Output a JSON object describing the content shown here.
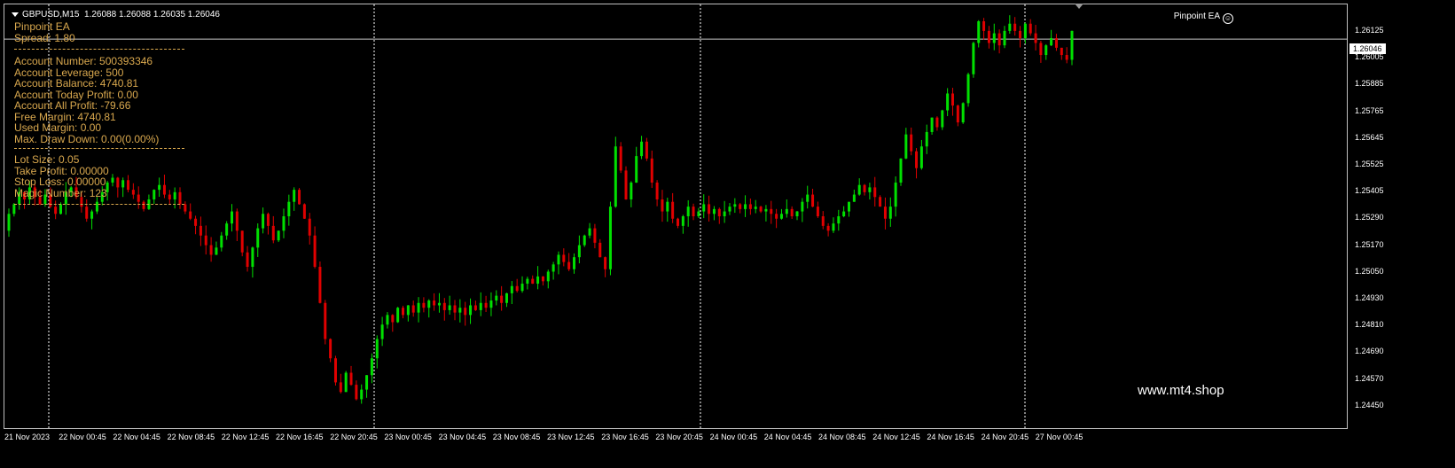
{
  "header": {
    "symbol": "GBPUSD,M15",
    "ohlc": "1.26088 1.26088 1.26035 1.26046",
    "ea_name": "Pinpoint EA",
    "ea_icon": "smiley-icon"
  },
  "info_panel": {
    "block1": [
      "Pinpoint EA",
      "Spread: 1.80"
    ],
    "block2": [
      "Account Number: 500393346",
      "Account Leverage: 500",
      "Account Balance: 4740.81",
      "Account Today Profit: 0.00",
      "Account All Profit: -79.66",
      "Free Margin: 4740.81",
      "Used Margin: 0.00",
      "Max. Draw Down: 0.00(0.00%)"
    ],
    "block3": [
      "Lot Size: 0.05",
      "Take Profit: 0.00000",
      "Stop Loss: 0.00000",
      "Magic Number: 123"
    ],
    "text_color": "#d9a84e"
  },
  "price_axis": {
    "ticks": [
      "1.26125",
      "1.26005",
      "1.25885",
      "1.25765",
      "1.25645",
      "1.25525",
      "1.25405",
      "1.25290",
      "1.25170",
      "1.25050",
      "1.24930",
      "1.24810",
      "1.24690",
      "1.24570",
      "1.24450"
    ],
    "current_price": "1.26046"
  },
  "time_axis": {
    "ticks": [
      "21 Nov 2023",
      "22 Nov 00:45",
      "22 Nov 04:45",
      "22 Nov 08:45",
      "22 Nov 12:45",
      "22 Nov 16:45",
      "22 Nov 20:45",
      "23 Nov 00:45",
      "23 Nov 04:45",
      "23 Nov 08:45",
      "23 Nov 12:45",
      "23 Nov 16:45",
      "23 Nov 20:45",
      "24 Nov 00:45",
      "24 Nov 04:45",
      "24 Nov 08:45",
      "24 Nov 12:45",
      "24 Nov 16:45",
      "24 Nov 20:45",
      "27 Nov 00:45"
    ],
    "day_separators": [
      "22 Nov 00:45",
      "23 Nov 00:45",
      "24 Nov 00:45",
      "27 Nov 00:45"
    ]
  },
  "colors": {
    "bull": "#00e000",
    "bear": "#e00000",
    "background": "#000000",
    "foreground": "#ffffff"
  },
  "watermark": "www.mt4.shop",
  "chart_data": {
    "type": "candlestick",
    "ylim": [
      1.2443,
      1.2619
    ],
    "closes": [
      1.2532,
      1.2536,
      1.2541,
      1.2538,
      1.2543,
      1.2539,
      1.2536,
      1.254,
      1.2535,
      1.2532,
      1.2536,
      1.2541,
      1.2543,
      1.2539,
      1.2535,
      1.253,
      1.2533,
      1.2537,
      1.2541,
      1.2545,
      1.2547,
      1.2543,
      1.2546,
      1.2542,
      1.254,
      1.2537,
      1.2534,
      1.2538,
      1.2542,
      1.2544,
      1.254,
      1.2538,
      1.2541,
      1.2536,
      1.2533,
      1.253,
      1.2527,
      1.2523,
      1.2519,
      1.2515,
      1.2518,
      1.2523,
      1.2528,
      1.2533,
      1.2525,
      1.2516,
      1.251,
      1.2518,
      1.2526,
      1.2532,
      1.2527,
      1.2521,
      1.2525,
      1.2531,
      1.2537,
      1.2542,
      1.2536,
      1.253,
      1.2523,
      1.251,
      1.2495,
      1.248,
      1.2472,
      1.2462,
      1.2458,
      1.2466,
      1.2461,
      1.2455,
      1.2459,
      1.2465,
      1.2472,
      1.248,
      1.2486,
      1.249,
      1.2487,
      1.2493,
      1.249,
      1.2494,
      1.2491,
      1.2495,
      1.2493,
      1.2496,
      1.2494,
      1.2495,
      1.2492,
      1.2494,
      1.2491,
      1.2493,
      1.249,
      1.2494,
      1.2492,
      1.2495,
      1.2493,
      1.2496,
      1.2498,
      1.2495,
      1.2499,
      1.2502,
      1.25,
      1.2503,
      1.2505,
      1.2503,
      1.2506,
      1.2504,
      1.2508,
      1.2511,
      1.2515,
      1.2512,
      1.2509,
      1.2514,
      1.2519,
      1.2523,
      1.2526,
      1.252,
      1.2514,
      1.2509,
      1.2535,
      1.256,
      1.255,
      1.2538,
      1.2545,
      1.2556,
      1.2562,
      1.2555,
      1.2545,
      1.2538,
      1.2533,
      1.2537,
      1.253,
      1.2527,
      1.2531,
      1.2535,
      1.2531,
      1.2533,
      1.2536,
      1.2532,
      1.2534,
      1.2531,
      1.2533,
      1.2535,
      1.2536,
      1.2534,
      1.2536,
      1.2534,
      1.2535,
      1.2533,
      1.2534,
      1.2532,
      1.253,
      1.2532,
      1.2534,
      1.2531,
      1.2533,
      1.2537,
      1.254,
      1.2535,
      1.2531,
      1.2527,
      1.2525,
      1.2528,
      1.2531,
      1.2533,
      1.2537,
      1.254,
      1.2544,
      1.2541,
      1.2543,
      1.2539,
      1.2535,
      1.253,
      1.2535,
      1.2545,
      1.2555,
      1.2565,
      1.2558,
      1.2551,
      1.256,
      1.2566,
      1.2572,
      1.2568,
      1.2575,
      1.2582,
      1.2577,
      1.257,
      1.2578,
      1.259,
      1.2603,
      1.2612,
      1.2608,
      1.2603,
      1.2607,
      1.2602,
      1.2608,
      1.2611,
      1.2608,
      1.2605,
      1.2611,
      1.2607,
      1.2603,
      1.2598,
      1.2602,
      1.2605,
      1.2601,
      1.2598,
      1.2596,
      1.2608
    ]
  }
}
